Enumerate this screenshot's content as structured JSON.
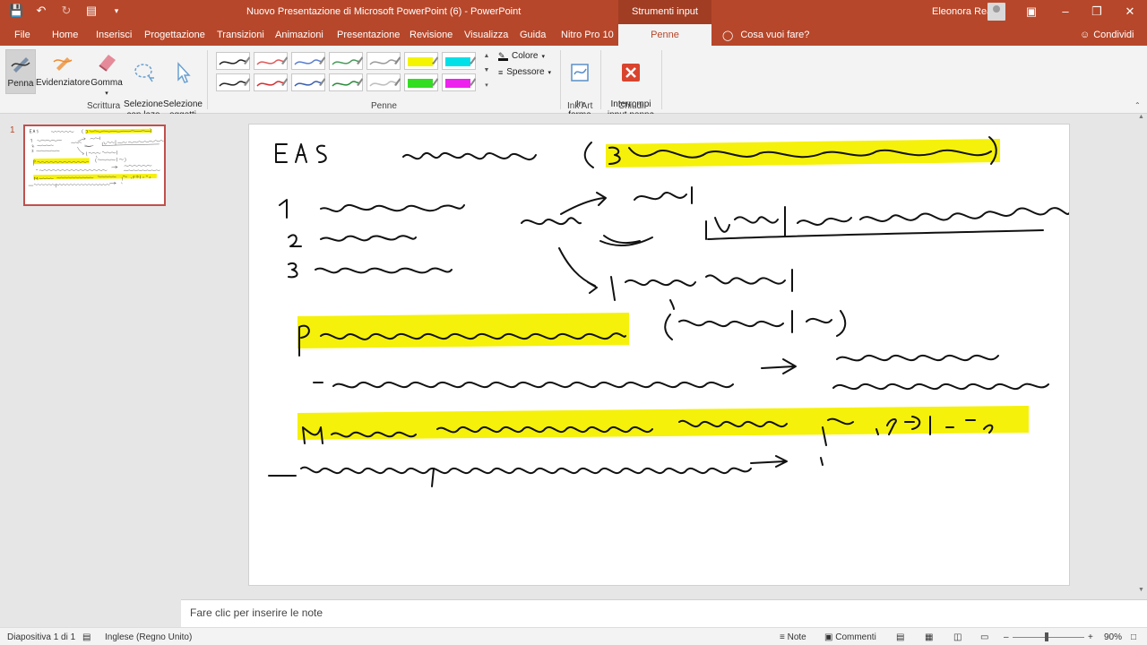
{
  "titlebar": {
    "document_title": "Nuovo Presentazione di Microsoft PowerPoint (6)  -  PowerPoint",
    "context_tab": "Strumenti input penna",
    "user_name": "Eleonora Rea"
  },
  "tabs": [
    "File",
    "Home",
    "Inserisci",
    "Progettazione",
    "Transizioni",
    "Animazioni",
    "Presentazione",
    "Revisione",
    "Visualizza",
    "Guida",
    "Nitro Pro 10",
    "Penne"
  ],
  "active_tab": "Penne",
  "tell_me": "Cosa vuoi fare?",
  "share": "Condividi",
  "ribbon": {
    "scrittura": {
      "label": "Scrittura",
      "buttons": [
        "Penna",
        "Evidenziatore",
        "Gomma",
        "Selezione\ncon lazo",
        "Selezione\noggetti"
      ]
    },
    "penne": {
      "label": "Penne",
      "colore": "Colore",
      "spessore": "Spessore",
      "pen_colors": [
        "#222222",
        "#e05a5a",
        "#5a7fd0",
        "#4a9a5a",
        "#9a9a9a",
        "#f4f400",
        "#00e0e8",
        "#222222",
        "#d03030",
        "#3a5fb0",
        "#2a8a3a",
        "#bdbdbd",
        "#33dd22",
        "#ee22ee"
      ]
    },
    "ink_art": {
      "label": "Ink Art",
      "button": "In\nforma"
    },
    "chiudi": {
      "label": "Chiudi",
      "button": "Interrompi\ninput penna"
    }
  },
  "slide": {
    "number": "1",
    "highlight_color": "#f5f10a",
    "ink_color": "#111111"
  },
  "notes_placeholder": "Fare clic per inserire le note",
  "status": {
    "slide_info": "Diapositiva 1 di 1",
    "language": "Inglese (Regno Unito)",
    "notes": "Note",
    "comments": "Commenti",
    "zoom": "90%"
  }
}
